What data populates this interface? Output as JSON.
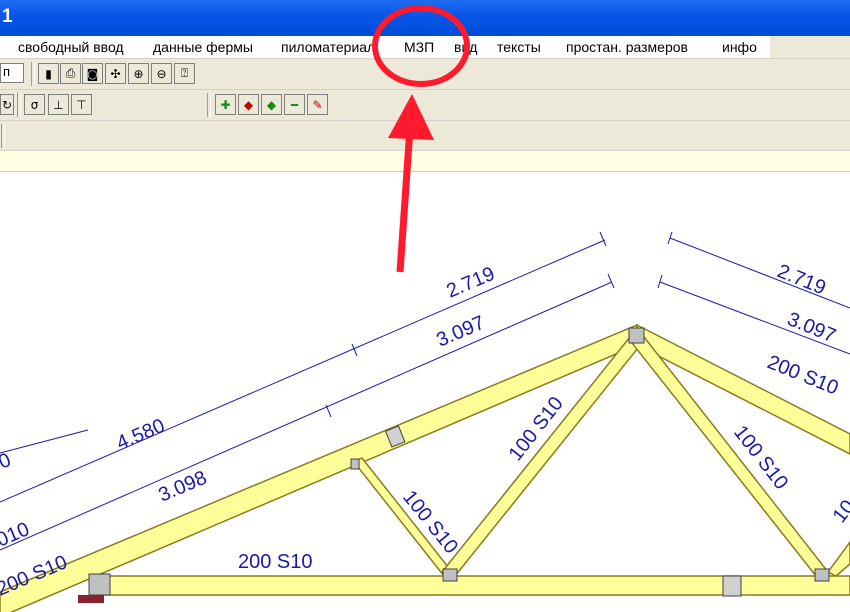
{
  "window": {
    "title_fragment": "1"
  },
  "menu": [
    "свободный ввод",
    "данные фермы",
    "пиломатериал",
    "МЗП",
    "вид",
    "тексты",
    "простан. размеров",
    "инфо"
  ],
  "toolbar": {
    "field_value": "п"
  },
  "drawing": {
    "dimensions": {
      "left_outer": "4.580",
      "left_inner": "3.098",
      "left_top_outer": "2.719",
      "left_top_inner": "3.097",
      "right_top_outer": "2.719",
      "right_top_inner": "3.097",
      "partial_a": "0",
      "partial_b": "010"
    },
    "members": {
      "top_chord_left": "200 S10",
      "top_chord_right": "200 S10",
      "bottom_chord": "200 S10",
      "web_1": "100 S10",
      "web_2": "100 S10",
      "web_3": "100 S10",
      "web_4": "10"
    }
  },
  "annotation": {
    "color": "#ff1a2e",
    "shape": "circle-with-arrow",
    "target": "МЗП"
  },
  "colors": {
    "timber": "#ffff99",
    "dimension": "#1a1aa8",
    "title": "#0a56e8"
  }
}
